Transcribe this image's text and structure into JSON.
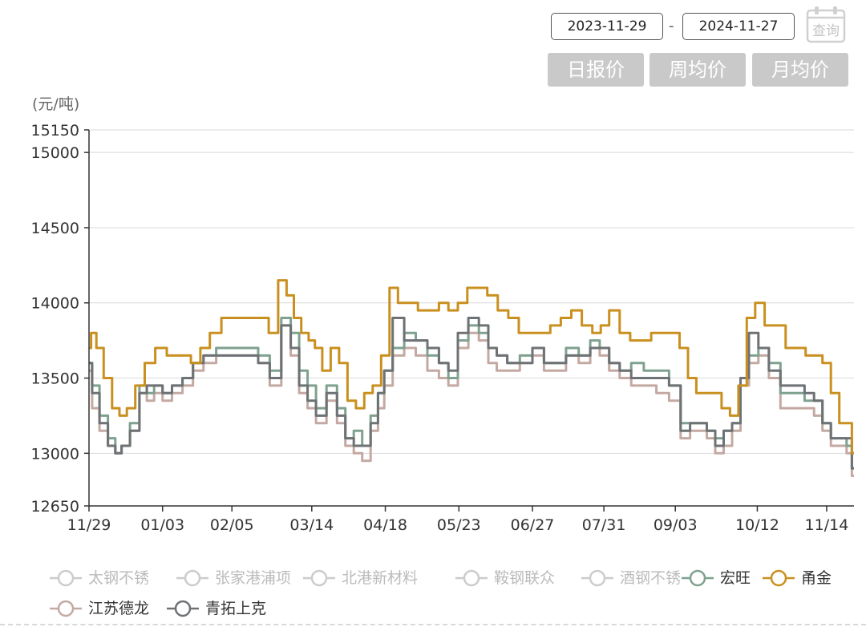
{
  "controls": {
    "start_date": "2023-11-29",
    "end_date": "2024-11-27",
    "separator": "-",
    "query_label": "查询",
    "tabs": [
      "日报价",
      "周均价",
      "月均价"
    ]
  },
  "chart_data": {
    "type": "line",
    "title": "",
    "xlabel": "",
    "ylabel": "(元/吨)",
    "ylim": [
      12650,
      15150
    ],
    "yticks": [
      12650,
      13000,
      13500,
      14000,
      14500,
      15000,
      15150
    ],
    "xlim": [
      "2023-11-29",
      "2024-11-27"
    ],
    "xticks": [
      {
        "label": "11/29",
        "date": "2023-11-29"
      },
      {
        "label": "01/03",
        "date": "2024-01-03"
      },
      {
        "label": "02/05",
        "date": "2024-02-05"
      },
      {
        "label": "03/14",
        "date": "2024-03-14"
      },
      {
        "label": "04/18",
        "date": "2024-04-18"
      },
      {
        "label": "05/23",
        "date": "2024-05-23"
      },
      {
        "label": "06/27",
        "date": "2024-06-27"
      },
      {
        "label": "07/31",
        "date": "2024-07-31"
      },
      {
        "label": "09/03",
        "date": "2024-09-03"
      },
      {
        "label": "10/12",
        "date": "2024-10-12"
      },
      {
        "label": "11/14",
        "date": "2024-11-14"
      }
    ],
    "grid": true,
    "legend_position": "bottom",
    "series": [
      {
        "name": "太钢不锈",
        "color": "#cccccc",
        "visible": false,
        "x": [],
        "y": []
      },
      {
        "name": "张家港浦项",
        "color": "#cccccc",
        "visible": false,
        "x": [],
        "y": []
      },
      {
        "name": "北港新材料",
        "color": "#5b8c99",
        "visible": false,
        "x": [],
        "y": []
      },
      {
        "name": "鞍钢联众",
        "color": "#c98d6a",
        "visible": false,
        "x": [],
        "y": []
      },
      {
        "name": "酒钢不锈",
        "color": "#cccccc",
        "visible": false,
        "x": [],
        "y": []
      },
      {
        "name": "宏旺",
        "color": "#7fa18f",
        "visible": true,
        "x": [
          "2023-11-29",
          "2023-12-02",
          "2023-12-06",
          "2023-12-10",
          "2023-12-13",
          "2023-12-16",
          "2023-12-21",
          "2023-12-25",
          "2023-12-28",
          "2024-01-01",
          "2024-01-05",
          "2024-01-10",
          "2024-01-15",
          "2024-01-20",
          "2024-01-25",
          "2024-02-01",
          "2024-02-08",
          "2024-02-15",
          "2024-02-20",
          "2024-02-26",
          "2024-03-02",
          "2024-03-06",
          "2024-03-10",
          "2024-03-14",
          "2024-03-18",
          "2024-03-24",
          "2024-03-28",
          "2024-04-01",
          "2024-04-05",
          "2024-04-09",
          "2024-04-13",
          "2024-04-16",
          "2024-04-19",
          "2024-04-24",
          "2024-04-30",
          "2024-05-05",
          "2024-05-11",
          "2024-05-16",
          "2024-05-20",
          "2024-05-25",
          "2024-05-30",
          "2024-06-04",
          "2024-06-08",
          "2024-06-12",
          "2024-06-18",
          "2024-06-24",
          "2024-06-30",
          "2024-07-05",
          "2024-07-10",
          "2024-07-16",
          "2024-07-22",
          "2024-07-27",
          "2024-07-31",
          "2024-08-05",
          "2024-08-10",
          "2024-08-16",
          "2024-08-22",
          "2024-08-28",
          "2024-09-03",
          "2024-09-08",
          "2024-09-12",
          "2024-09-16",
          "2024-09-20",
          "2024-09-24",
          "2024-09-28",
          "2024-10-02",
          "2024-10-06",
          "2024-10-10",
          "2024-10-15",
          "2024-10-20",
          "2024-10-26",
          "2024-11-01",
          "2024-11-06",
          "2024-11-10",
          "2024-11-14",
          "2024-11-18",
          "2024-11-22",
          "2024-11-25",
          "2024-11-27"
        ],
        "y": [
          13600,
          13450,
          13250,
          13100,
          13000,
          13050,
          13200,
          13450,
          13400,
          13450,
          13400,
          13450,
          13500,
          13600,
          13650,
          13700,
          13700,
          13700,
          13650,
          13550,
          13900,
          13800,
          13550,
          13450,
          13300,
          13450,
          13300,
          13100,
          13150,
          13050,
          13250,
          13400,
          13550,
          13700,
          13800,
          13750,
          13650,
          13600,
          13500,
          13750,
          13850,
          13800,
          13700,
          13650,
          13600,
          13650,
          13700,
          13600,
          13600,
          13700,
          13650,
          13750,
          13700,
          13600,
          13550,
          13600,
          13550,
          13550,
          13450,
          13200,
          13200,
          13200,
          13150,
          13100,
          13150,
          13200,
          13500,
          13650,
          13700,
          13600,
          13400,
          13400,
          13350,
          13350,
          13200,
          13100,
          13100,
          13050,
          12900
        ]
      },
      {
        "name": "甬金",
        "color": "#c9901f",
        "visible": true,
        "x": [
          "2023-11-29",
          "2023-12-01",
          "2023-12-04",
          "2023-12-08",
          "2023-12-12",
          "2023-12-15",
          "2023-12-19",
          "2023-12-23",
          "2023-12-28",
          "2024-01-02",
          "2024-01-08",
          "2024-01-14",
          "2024-01-19",
          "2024-01-23",
          "2024-01-28",
          "2024-02-03",
          "2024-02-09",
          "2024-02-15",
          "2024-02-20",
          "2024-02-25",
          "2024-02-29",
          "2024-03-04",
          "2024-03-07",
          "2024-03-11",
          "2024-03-14",
          "2024-03-17",
          "2024-03-21",
          "2024-03-25",
          "2024-03-29",
          "2024-04-02",
          "2024-04-06",
          "2024-04-10",
          "2024-04-14",
          "2024-04-18",
          "2024-04-22",
          "2024-04-26",
          "2024-05-01",
          "2024-05-06",
          "2024-05-11",
          "2024-05-16",
          "2024-05-20",
          "2024-05-25",
          "2024-05-29",
          "2024-06-03",
          "2024-06-08",
          "2024-06-13",
          "2024-06-18",
          "2024-06-23",
          "2024-06-28",
          "2024-07-03",
          "2024-07-08",
          "2024-07-13",
          "2024-07-18",
          "2024-07-23",
          "2024-07-28",
          "2024-07-31",
          "2024-08-05",
          "2024-08-10",
          "2024-08-15",
          "2024-08-20",
          "2024-08-25",
          "2024-08-30",
          "2024-09-03",
          "2024-09-07",
          "2024-09-11",
          "2024-09-15",
          "2024-09-19",
          "2024-09-23",
          "2024-09-27",
          "2024-10-01",
          "2024-10-05",
          "2024-10-09",
          "2024-10-13",
          "2024-10-18",
          "2024-10-23",
          "2024-10-28",
          "2024-11-02",
          "2024-11-06",
          "2024-11-10",
          "2024-11-14",
          "2024-11-18",
          "2024-11-22",
          "2024-11-25",
          "2024-11-27"
        ],
        "y": [
          13700,
          13800,
          13700,
          13500,
          13300,
          13250,
          13300,
          13450,
          13600,
          13700,
          13650,
          13650,
          13600,
          13700,
          13800,
          13900,
          13900,
          13900,
          13900,
          13800,
          14150,
          14050,
          13900,
          13800,
          13750,
          13700,
          13550,
          13700,
          13600,
          13350,
          13300,
          13400,
          13450,
          13650,
          14100,
          14000,
          14000,
          13950,
          13950,
          14000,
          13950,
          14000,
          14100,
          14100,
          14050,
          13950,
          13900,
          13800,
          13800,
          13800,
          13850,
          13900,
          13950,
          13850,
          13800,
          13850,
          13950,
          13800,
          13750,
          13750,
          13800,
          13800,
          13800,
          13700,
          13500,
          13400,
          13400,
          13400,
          13300,
          13250,
          13450,
          13900,
          14000,
          13850,
          13850,
          13700,
          13700,
          13650,
          13650,
          13600,
          13400,
          13200,
          13200,
          13000
        ]
      },
      {
        "name": "江苏德龙",
        "color": "#c4a9a3",
        "visible": true,
        "x": [
          "2023-11-29",
          "2023-12-02",
          "2023-12-06",
          "2023-12-10",
          "2023-12-13",
          "2023-12-16",
          "2023-12-21",
          "2023-12-25",
          "2023-12-28",
          "2024-01-01",
          "2024-01-05",
          "2024-01-10",
          "2024-01-15",
          "2024-01-20",
          "2024-01-25",
          "2024-02-01",
          "2024-02-08",
          "2024-02-15",
          "2024-02-20",
          "2024-02-26",
          "2024-03-02",
          "2024-03-06",
          "2024-03-10",
          "2024-03-14",
          "2024-03-18",
          "2024-03-24",
          "2024-03-28",
          "2024-04-01",
          "2024-04-05",
          "2024-04-09",
          "2024-04-13",
          "2024-04-16",
          "2024-04-19",
          "2024-04-24",
          "2024-04-30",
          "2024-05-05",
          "2024-05-11",
          "2024-05-16",
          "2024-05-20",
          "2024-05-25",
          "2024-05-30",
          "2024-06-04",
          "2024-06-08",
          "2024-06-12",
          "2024-06-18",
          "2024-06-24",
          "2024-06-30",
          "2024-07-05",
          "2024-07-10",
          "2024-07-16",
          "2024-07-22",
          "2024-07-27",
          "2024-07-31",
          "2024-08-05",
          "2024-08-10",
          "2024-08-16",
          "2024-08-22",
          "2024-08-28",
          "2024-09-03",
          "2024-09-08",
          "2024-09-12",
          "2024-09-16",
          "2024-09-20",
          "2024-09-24",
          "2024-09-28",
          "2024-10-02",
          "2024-10-06",
          "2024-10-10",
          "2024-10-15",
          "2024-10-20",
          "2024-10-26",
          "2024-11-01",
          "2024-11-06",
          "2024-11-10",
          "2024-11-14",
          "2024-11-18",
          "2024-11-22",
          "2024-11-25",
          "2024-11-27"
        ],
        "y": [
          13550,
          13300,
          13150,
          13050,
          13000,
          13050,
          13150,
          13400,
          13350,
          13400,
          13350,
          13400,
          13450,
          13550,
          13600,
          13650,
          13650,
          13650,
          13600,
          13450,
          13850,
          13650,
          13400,
          13300,
          13200,
          13350,
          13200,
          13050,
          13000,
          12950,
          13150,
          13300,
          13450,
          13650,
          13700,
          13650,
          13550,
          13500,
          13450,
          13700,
          13800,
          13750,
          13600,
          13550,
          13550,
          13600,
          13650,
          13550,
          13550,
          13650,
          13600,
          13700,
          13650,
          13550,
          13500,
          13450,
          13450,
          13400,
          13350,
          13100,
          13150,
          13150,
          13100,
          13000,
          13050,
          13150,
          13450,
          13600,
          13650,
          13500,
          13300,
          13300,
          13300,
          13250,
          13150,
          13050,
          13050,
          13000,
          12850
        ]
      },
      {
        "name": "青拓上克",
        "color": "#6e7275",
        "visible": true,
        "x": [
          "2023-11-29",
          "2023-12-02",
          "2023-12-06",
          "2023-12-10",
          "2023-12-13",
          "2023-12-16",
          "2023-12-21",
          "2023-12-25",
          "2023-12-28",
          "2024-01-01",
          "2024-01-05",
          "2024-01-10",
          "2024-01-15",
          "2024-01-20",
          "2024-01-25",
          "2024-02-01",
          "2024-02-08",
          "2024-02-15",
          "2024-02-20",
          "2024-02-26",
          "2024-03-02",
          "2024-03-06",
          "2024-03-10",
          "2024-03-14",
          "2024-03-18",
          "2024-03-24",
          "2024-03-28",
          "2024-04-01",
          "2024-04-05",
          "2024-04-09",
          "2024-04-13",
          "2024-04-16",
          "2024-04-19",
          "2024-04-24",
          "2024-04-30",
          "2024-05-05",
          "2024-05-11",
          "2024-05-16",
          "2024-05-20",
          "2024-05-25",
          "2024-05-30",
          "2024-06-04",
          "2024-06-08",
          "2024-06-12",
          "2024-06-18",
          "2024-06-24",
          "2024-06-30",
          "2024-07-05",
          "2024-07-10",
          "2024-07-16",
          "2024-07-22",
          "2024-07-27",
          "2024-07-31",
          "2024-08-05",
          "2024-08-10",
          "2024-08-16",
          "2024-08-22",
          "2024-08-28",
          "2024-09-03",
          "2024-09-08",
          "2024-09-12",
          "2024-09-16",
          "2024-09-20",
          "2024-09-24",
          "2024-09-28",
          "2024-10-02",
          "2024-10-06",
          "2024-10-10",
          "2024-10-15",
          "2024-10-20",
          "2024-10-26",
          "2024-11-01",
          "2024-11-06",
          "2024-11-10",
          "2024-11-14",
          "2024-11-18",
          "2024-11-22",
          "2024-11-25",
          "2024-11-27"
        ],
        "y": [
          13600,
          13400,
          13200,
          13050,
          13000,
          13050,
          13150,
          13400,
          13450,
          13450,
          13400,
          13450,
          13500,
          13600,
          13650,
          13650,
          13650,
          13650,
          13600,
          13500,
          13850,
          13700,
          13450,
          13350,
          13250,
          13400,
          13250,
          13100,
          13050,
          13050,
          13200,
          13400,
          13550,
          13900,
          13750,
          13750,
          13700,
          13600,
          13550,
          13800,
          13900,
          13850,
          13700,
          13650,
          13600,
          13600,
          13700,
          13600,
          13600,
          13650,
          13650,
          13700,
          13700,
          13600,
          13550,
          13500,
          13500,
          13500,
          13450,
          13150,
          13200,
          13200,
          13150,
          13050,
          13150,
          13200,
          13500,
          13800,
          13700,
          13550,
          13450,
          13450,
          13400,
          13350,
          13200,
          13100,
          13100,
          13100,
          12900
        ]
      }
    ]
  }
}
